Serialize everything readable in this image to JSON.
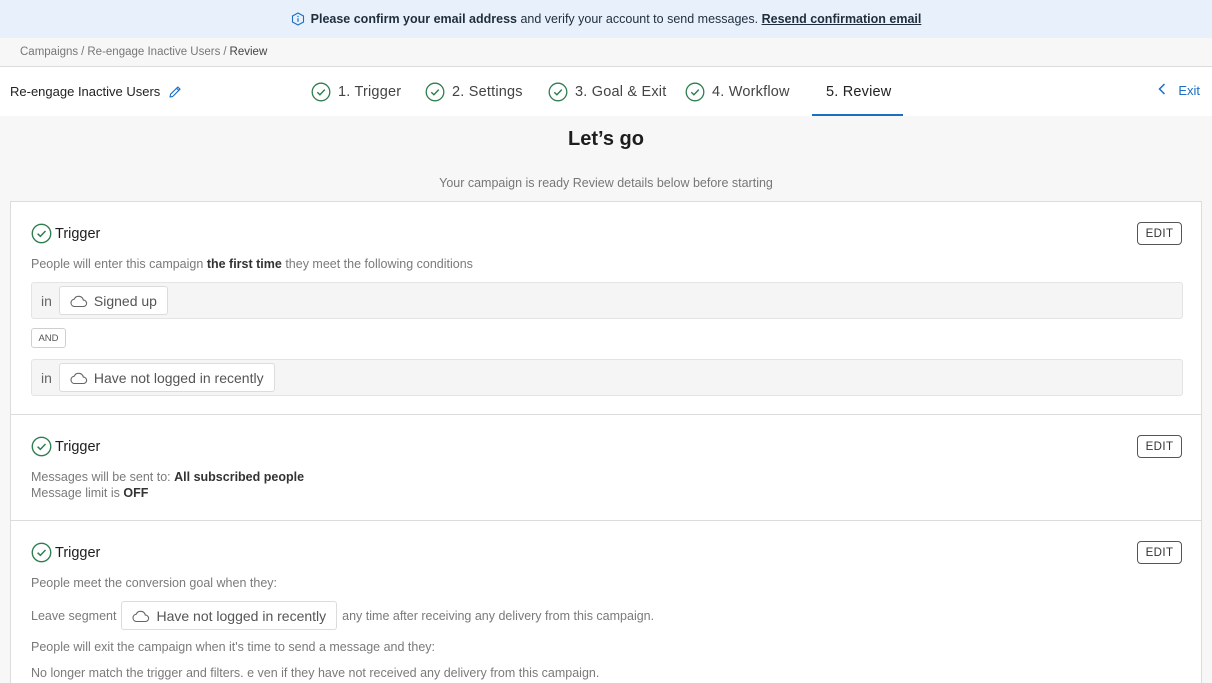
{
  "banner": {
    "bold_text": "Please confirm your email address",
    "text": "and verify your account to send messages.",
    "link": "Resend confirmation email"
  },
  "breadcrumb": {
    "items": [
      "Campaigns",
      "Re-engage Inactive Users"
    ],
    "separator": "/",
    "current": "Review"
  },
  "header": {
    "campaign_name": "Re-engage Inactive Users",
    "steps": [
      {
        "label": "1. Trigger",
        "done": true
      },
      {
        "label": "2. Settings",
        "done": true
      },
      {
        "label": "3. Goal & Exit",
        "done": true
      },
      {
        "label": "4. Workflow",
        "done": true
      },
      {
        "label": "5. Review",
        "active": true
      }
    ],
    "exit_label": "Exit"
  },
  "main": {
    "title": "Let’s go",
    "subtitle": "Your campaign is ready  Review details below before starting"
  },
  "cards": [
    {
      "title": "Trigger",
      "edit_label": "EDIT",
      "desc_pre": "People will enter this campaign",
      "desc_bold": "the first time",
      "desc_post": "they meet the following conditions",
      "conditions": [
        {
          "prefix": "in",
          "segment": "Signed up"
        },
        {
          "prefix": "in",
          "segment": "Have not logged in recently"
        }
      ],
      "and_label": "AND"
    },
    {
      "title": "Trigger",
      "edit_label": "EDIT",
      "line1_label": "Messages will be sent to:",
      "line1_value": "All subscribed people",
      "line2_label": "Message limit is",
      "line2_value": "OFF"
    },
    {
      "title": "Trigger",
      "edit_label": "EDIT",
      "goal_text": "People meet the conversion goal when they:",
      "leave_label": "Leave segment",
      "segment": "Have not logged in recently",
      "leave_suffix": "any time after receiving any delivery from this campaign.",
      "exit_text": "People will exit the campaign when it's time to send a message and they:",
      "exit_condition": "No longer match the trigger and filters. e ven if they have not received any delivery from this campaign."
    }
  ],
  "colors": {
    "accent": "#1a6fc4",
    "check_green": "#2e7d4f",
    "banner_bg": "#e8f1fb"
  },
  "icons": [
    "info-icon",
    "pencil-icon",
    "check-circle-icon",
    "chevron-left-icon",
    "cloud-icon"
  ]
}
